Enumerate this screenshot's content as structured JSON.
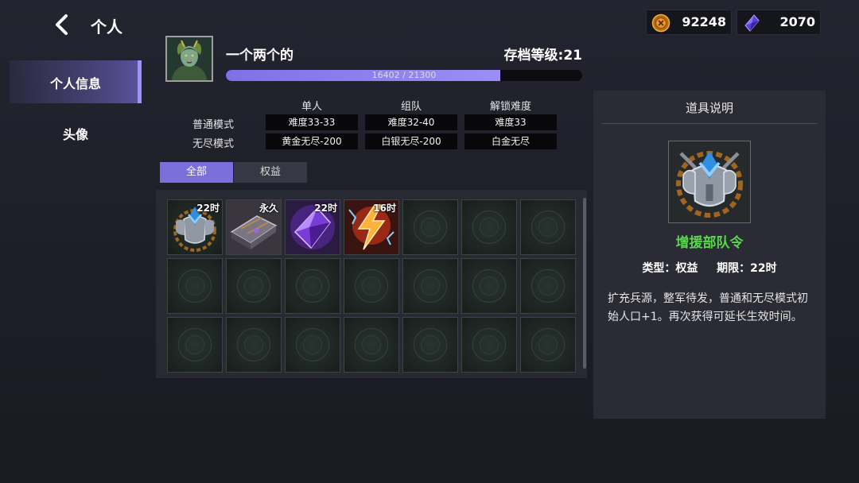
{
  "header": {
    "title": "个人"
  },
  "currencies": {
    "gold": {
      "value": "92248",
      "icon": "gold-coin-icon",
      "color": "#e09a22"
    },
    "gem": {
      "value": "2070",
      "icon": "purple-crystal-icon",
      "color": "#7a5cff"
    }
  },
  "sidebar": {
    "items": [
      {
        "label": "个人信息",
        "selected": true
      },
      {
        "label": "头像",
        "selected": false
      }
    ]
  },
  "profile": {
    "name": "一个两个的",
    "save_level": "存档等级:21",
    "xp_current": 16402,
    "xp_max": 21300,
    "xp_text": "16402 / 21300"
  },
  "difficulty": {
    "columns": [
      "单人",
      "组队",
      "解锁难度"
    ],
    "rows": [
      {
        "label": "普通模式",
        "cells": [
          "难度33-33",
          "难度32-40",
          "难度33"
        ]
      },
      {
        "label": "无尽模式",
        "cells": [
          "黄金无尽-200",
          "白银无尽-200",
          "白金无尽"
        ]
      }
    ]
  },
  "filters": {
    "tabs": [
      {
        "label": "全部",
        "active": true
      },
      {
        "label": "权益",
        "active": false
      }
    ]
  },
  "items": [
    {
      "icon": "armor-emblem-icon",
      "duration": "22时"
    },
    {
      "icon": "treasure-chest-icon",
      "duration": "永久"
    },
    {
      "icon": "purple-crystal-icon",
      "duration": "22时"
    },
    {
      "icon": "lightning-boost-icon",
      "duration": "16时"
    }
  ],
  "detail": {
    "panel_title": "道具说明",
    "icon": "armor-emblem-icon",
    "name": "增援部队令",
    "type_label": "类型：权益",
    "term_label": "期限：22时",
    "description": "扩充兵源，整军待发，普通和无尽模式初始人口+1。再次获得可延长生效时间。"
  },
  "colors": {
    "accent": "#7b6fdc",
    "item_name": "#58d64d",
    "selected_tab_bar": "#9f92ff"
  }
}
